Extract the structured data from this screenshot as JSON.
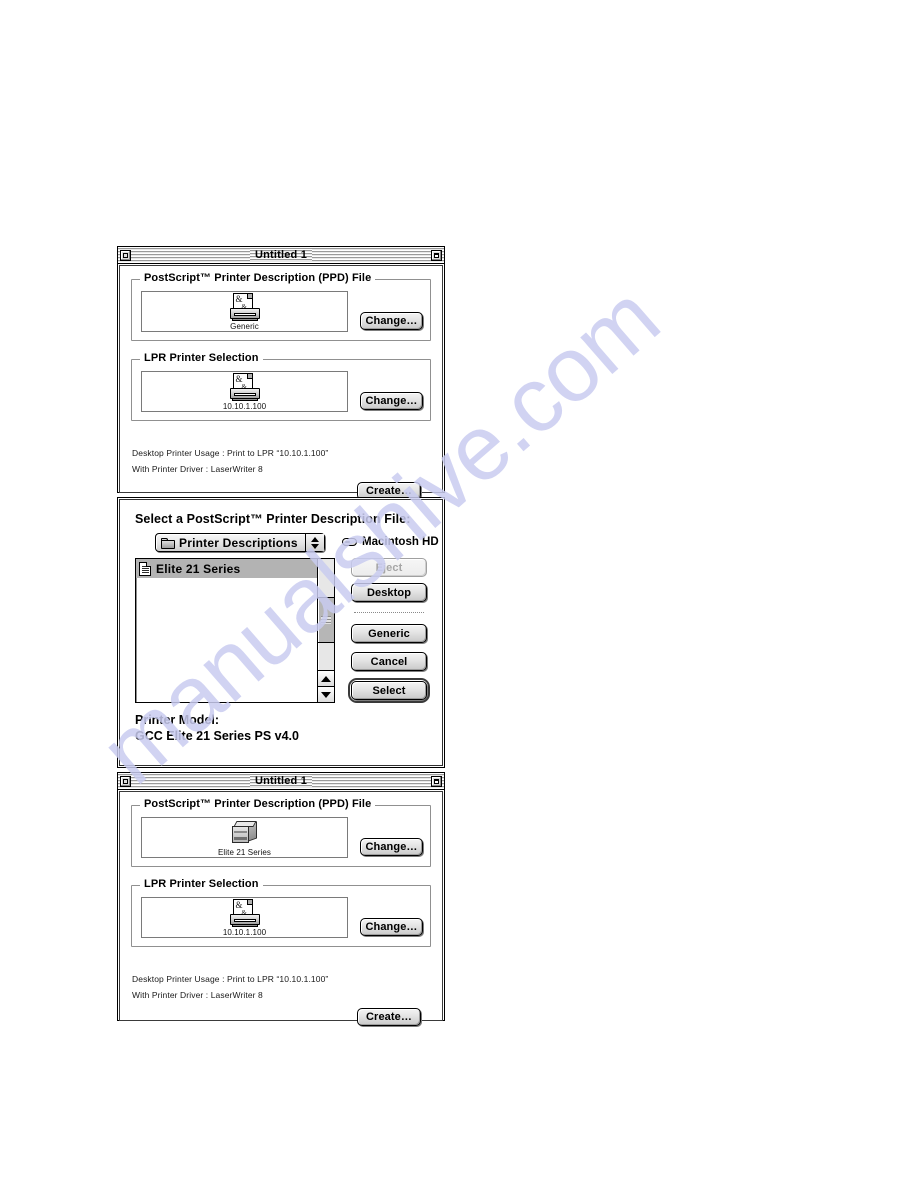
{
  "watermark": {
    "text": "manualshive.com"
  },
  "window_top": {
    "title": "Untitled 1",
    "close_box": "close-box",
    "collapse_box": "collapse-box",
    "ppd_group": {
      "title": "PostScript™ Printer Description (PPD) File",
      "icon_name": "ppd-file-icon",
      "icon_label": "Generic",
      "change_button": "Change…"
    },
    "lpr_group": {
      "title": "LPR Printer Selection",
      "icon_name": "ppd-file-icon",
      "icon_label": "10.10.1.100",
      "change_button": "Change…"
    },
    "usage_line": "Desktop Printer Usage : Print to LPR “10.10.1.100”",
    "driver_line": "With Printer Driver : LaserWriter 8",
    "create_button": "Create…"
  },
  "dialog_select": {
    "heading": "Select a PostScript™ Printer Description File:",
    "popup": {
      "label": "Printer Descriptions",
      "icon_name": "folder-icon"
    },
    "volume": {
      "label": "Macintosh HD",
      "icon_name": "disk-icon"
    },
    "file_list": [
      {
        "name": "Elite 21 Series",
        "selected": true
      }
    ],
    "buttons": {
      "eject": "Eject",
      "desktop": "Desktop",
      "generic": "Generic",
      "cancel": "Cancel",
      "select": "Select"
    },
    "eject_disabled": true,
    "default_button": "Select",
    "printer_model_label": "Printer Model:",
    "printer_model_value": "GCC Elite 21 Series PS v4.0"
  },
  "window_bottom": {
    "title": "Untitled 1",
    "ppd_group": {
      "title": "PostScript™ Printer Description (PPD) File",
      "icon_name": "laser-printer-icon",
      "icon_label": "Elite 21 Series",
      "change_button": "Change…"
    },
    "lpr_group": {
      "title": "LPR Printer Selection",
      "icon_name": "ppd-file-icon",
      "icon_label": "10.10.1.100",
      "change_button": "Change…"
    },
    "usage_line": "Desktop Printer Usage : Print to LPR “10.10.1.100”",
    "driver_line": "With Printer Driver : LaserWriter 8",
    "create_button": "Create…"
  }
}
